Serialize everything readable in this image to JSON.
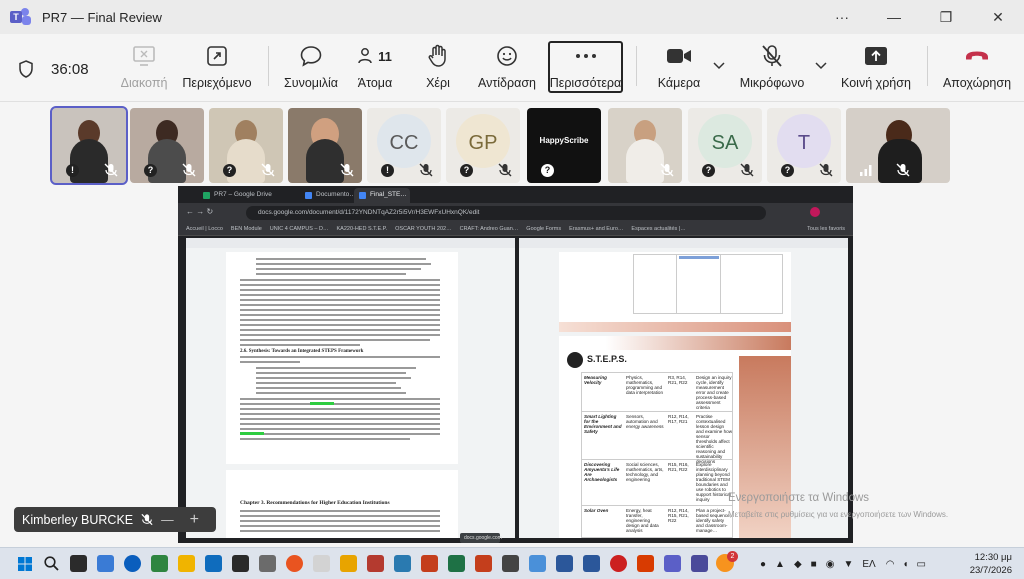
{
  "window": {
    "title": "PR7 — Final Review",
    "controls": [
      "···",
      "—",
      "❐",
      "✕"
    ]
  },
  "toolbar": {
    "timer": "36:08",
    "buttons": [
      {
        "label": "Διακοπή",
        "disabled": true
      },
      {
        "label": "Περιεχόμενο"
      },
      {
        "label": "Συνομιλία"
      },
      {
        "label": "Άτομα",
        "count": "11"
      },
      {
        "label": "Χέρι"
      },
      {
        "label": "Αντίδραση"
      },
      {
        "label": "Περισσότερα"
      },
      {
        "label": "Κάμερα"
      },
      {
        "label": "Μικρόφωνο"
      },
      {
        "label": "Κοινή χρήση"
      },
      {
        "label": "Αποχώρηση"
      }
    ]
  },
  "participants": [
    {
      "kind": "video",
      "selected": true
    },
    {
      "kind": "video"
    },
    {
      "kind": "video"
    },
    {
      "kind": "video"
    },
    {
      "kind": "initials",
      "initials": "CC"
    },
    {
      "kind": "initials",
      "initials": "GP"
    },
    {
      "kind": "logo",
      "logo_text": "HappyScribe"
    },
    {
      "kind": "video"
    },
    {
      "kind": "initials",
      "initials": "SA"
    },
    {
      "kind": "initials",
      "initials": "T"
    },
    {
      "kind": "video"
    }
  ],
  "shared_screen": {
    "tabs": [
      "PR7 – Google Drive",
      "Documento…",
      "Final_STE…"
    ],
    "address": "docs.google.com/document/d/1172YNDNTqAZ2r5i5Vr/H3EWFxUHxnQK/edit",
    "bookmarks": [
      "Accueil | Locco",
      "BEN Module",
      "UNIC 4 CAMPUS – D…",
      "KA220-HED S.T.E.P.",
      "OSCAR YOUTH 202…",
      "CRAFT: Andreo Guan…",
      "Google Forms",
      "Erasmus+ and Euro…",
      "Espaces actualités |…",
      "Tous les favoris"
    ],
    "left_doc": {
      "heading1": "2.6. Synthesis: Towards an Integrated STEPS Framework",
      "heading2": "Chapter 3. Recommendations for Higher Education Institutions"
    },
    "right_doc": {
      "logo_text": "S.T.E.P.S.",
      "rows": [
        {
          "title": "Measuring Velocity",
          "fields": "Physics, mathematics, programming and data interpretation",
          "codes": "R3, R14, R21, R22",
          "desc": "Design an inquiry cycle, identify measurement error and create process-based assessment criteria"
        },
        {
          "title": "Smart Lighting for the Environment and Safety",
          "fields": "Sensors, automation and energy awareness",
          "codes": "R12, R14, R17, R21",
          "desc": "Practise contextualised lesson design and examine how sensor thresholds affect scientific reasoning and sustainability decisions"
        },
        {
          "title": "Discovering Amyuenta's Life Are Archaeologists",
          "fields": "Social sciences, mathematics, arts, technology, and engineering",
          "codes": "R15, R16, R21, R22",
          "desc": "Explore interdisciplinary planning beyond traditional STEM boundaries and use robotics to support historical inquiry"
        },
        {
          "title": "Solar Oven",
          "fields": "Energy, heat transfer, engineering design and data analysis",
          "codes": "R12, R14, R15, R21, R22",
          "desc": "Plan a project-based sequence, identify safety and classroom-manage…"
        }
      ]
    },
    "taskbar_hint": "docs.google.com"
  },
  "presenter": {
    "name": "Kimberley BURCKE"
  },
  "activation": {
    "line1": "Ενεργοποιήστε τα Windows",
    "line2": "Μεταβείτε στις ρυθμίσεις για να ενεργοποιήσετε των Windows."
  },
  "system": {
    "time": "12:30 μμ",
    "date": "23/7/2026",
    "lang": "ΕΛ",
    "badge": "2"
  }
}
